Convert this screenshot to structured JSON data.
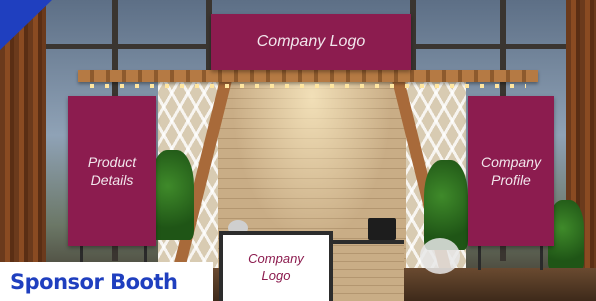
{
  "banners": {
    "top": "Company Logo",
    "left": "Product Details",
    "right": "Company Profile",
    "counter": "Company Logo"
  },
  "label": {
    "sponsor_booth": "Sponsor Booth"
  },
  "colors": {
    "banner": "#8c1c4f",
    "label_text": "#1f3fbf",
    "accent_corner": "#1f3fbf",
    "counter": "#ffffff"
  }
}
